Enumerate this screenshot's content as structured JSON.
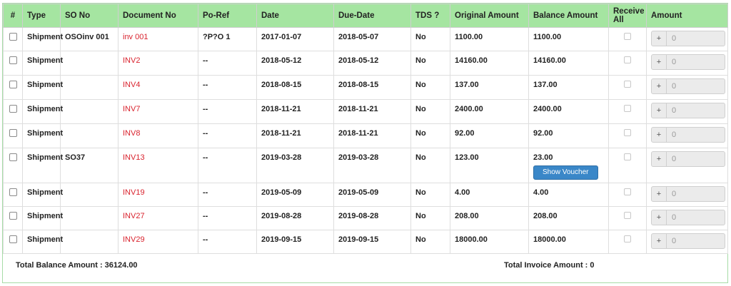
{
  "columns": [
    "#",
    "Type",
    "SO No",
    "Document No",
    "Po-Ref",
    "Date",
    "Due-Date",
    "TDS ?",
    "Original Amount",
    "Balance Amount",
    "Receive All",
    "Amount"
  ],
  "rows": [
    {
      "type": "Shipment",
      "so_no": "OSOinv 001",
      "doc_no": "inv 001",
      "po_ref": "?P?O 1",
      "date": "2017-01-07",
      "due_date": "2018-05-07",
      "tds": "No",
      "original": "1100.00",
      "balance": "1100.00",
      "amount": "0"
    },
    {
      "type": "Shipment",
      "so_no": "",
      "doc_no": "INV2",
      "po_ref": "--",
      "date": "2018-05-12",
      "due_date": "2018-05-12",
      "tds": "No",
      "original": "14160.00",
      "balance": "14160.00",
      "amount": "0"
    },
    {
      "type": "Shipment",
      "so_no": "",
      "doc_no": "INV4",
      "po_ref": "--",
      "date": "2018-08-15",
      "due_date": "2018-08-15",
      "tds": "No",
      "original": "137.00",
      "balance": "137.00",
      "amount": "0"
    },
    {
      "type": "Shipment",
      "so_no": "",
      "doc_no": "INV7",
      "po_ref": "--",
      "date": "2018-11-21",
      "due_date": "2018-11-21",
      "tds": "No",
      "original": "2400.00",
      "balance": "2400.00",
      "amount": "0"
    },
    {
      "type": "Shipment",
      "so_no": "",
      "doc_no": "INV8",
      "po_ref": "--",
      "date": "2018-11-21",
      "due_date": "2018-11-21",
      "tds": "No",
      "original": "92.00",
      "balance": "92.00",
      "amount": "0"
    },
    {
      "type": "Shipment",
      "so_no": "SO37",
      "doc_no": "INV13",
      "po_ref": "--",
      "date": "2019-03-28",
      "due_date": "2019-03-28",
      "tds": "No",
      "original": "123.00",
      "balance": "23.00",
      "amount": "0",
      "voucher_label": "Show Voucher"
    },
    {
      "type": "Shipment",
      "so_no": "",
      "doc_no": "INV19",
      "po_ref": "--",
      "date": "2019-05-09",
      "due_date": "2019-05-09",
      "tds": "No",
      "original": "4.00",
      "balance": "4.00",
      "amount": "0"
    },
    {
      "type": "Shipment",
      "so_no": "",
      "doc_no": "INV27",
      "po_ref": "--",
      "date": "2019-08-28",
      "due_date": "2019-08-28",
      "tds": "No",
      "original": "208.00",
      "balance": "208.00",
      "amount": "0"
    },
    {
      "type": "Shipment",
      "so_no": "",
      "doc_no": "INV29",
      "po_ref": "--",
      "date": "2019-09-15",
      "due_date": "2019-09-15",
      "tds": "No",
      "original": "18000.00",
      "balance": "18000.00",
      "amount": "0"
    }
  ],
  "amount_button_label": "+",
  "footer": {
    "total_balance": "Total Balance Amount : 36124.00",
    "total_invoice": "Total Invoice Amount : 0"
  },
  "colors": {
    "header_bg": "#a5e5a1",
    "link": "#d9232e",
    "button": "#3a87c8",
    "border": "#a6dca6"
  },
  "icons": {
    "plus": "plus-icon"
  }
}
